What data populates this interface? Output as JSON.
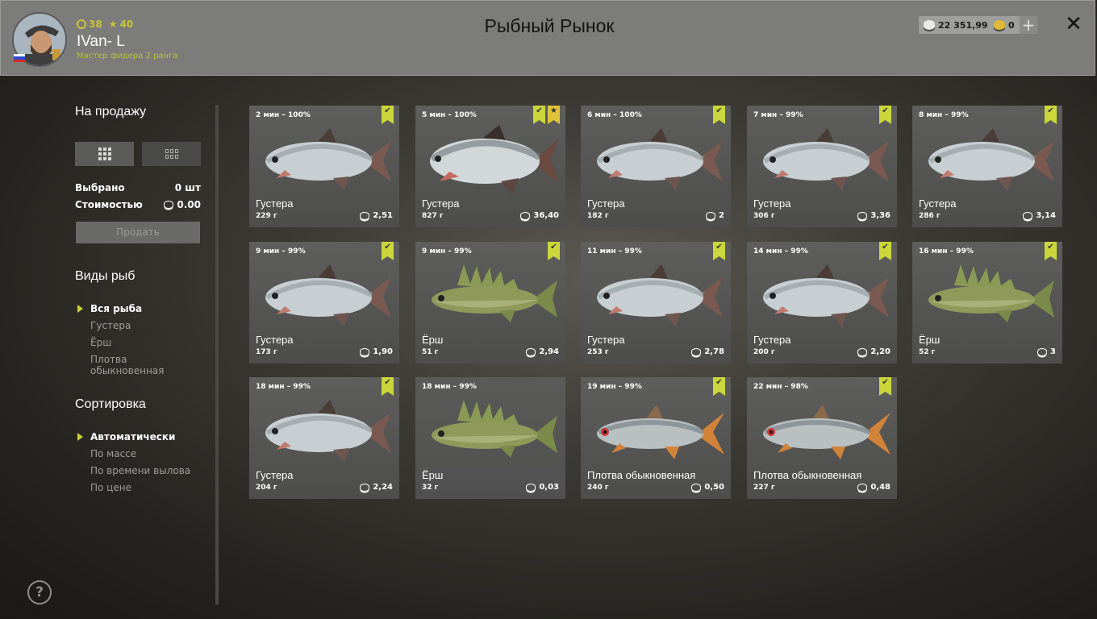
{
  "header": {
    "title": "Рыбный Рынок",
    "player": {
      "name": "IVan- L",
      "rank": "Мастер фидера 2 ранга",
      "level": "38",
      "stars": "40"
    },
    "currency": {
      "silver": "22 351,99",
      "gold": "0"
    },
    "plus_label": "+",
    "close_label": "✕"
  },
  "sale": {
    "title": "На продажу",
    "selected_label": "Выбрано",
    "selected_value": "0 шт",
    "cost_label": "Стоимостью",
    "cost_value": "0.00",
    "sell_label": "Продать"
  },
  "species": {
    "title": "Виды рыб",
    "items": [
      "Вся рыба",
      "Густера",
      "Ёрш",
      "Плотва обыкновенная"
    ]
  },
  "sorting": {
    "title": "Сортировка",
    "items": [
      "Автоматически",
      "По массе",
      "По времени вылова",
      "По цене"
    ]
  },
  "help_label": "?",
  "fish": [
    {
      "time": "2 мин – 100%",
      "name": "Густера",
      "weight": "229 г",
      "price": "2,51",
      "species": "bream",
      "check": true,
      "star": false
    },
    {
      "time": "5 мин – 100%",
      "name": "Густера",
      "weight": "827 г",
      "price": "36,40",
      "species": "bream-big",
      "check": true,
      "star": true
    },
    {
      "time": "6 мин – 100%",
      "name": "Густера",
      "weight": "182 г",
      "price": "2",
      "species": "bream",
      "check": true,
      "star": false
    },
    {
      "time": "7 мин – 99%",
      "name": "Густера",
      "weight": "306 г",
      "price": "3,36",
      "species": "bream",
      "check": true,
      "star": false
    },
    {
      "time": "8 мин – 99%",
      "name": "Густера",
      "weight": "286 г",
      "price": "3,14",
      "species": "bream",
      "check": true,
      "star": false
    },
    {
      "time": "9 мин – 99%",
      "name": "Густера",
      "weight": "173 г",
      "price": "1,90",
      "species": "bream",
      "check": true,
      "star": false
    },
    {
      "time": "9 мин – 99%",
      "name": "Ёрш",
      "weight": "51 г",
      "price": "2,94",
      "species": "ruffe",
      "check": true,
      "star": false
    },
    {
      "time": "11 мин – 99%",
      "name": "Густера",
      "weight": "253 г",
      "price": "2,78",
      "species": "bream",
      "check": true,
      "star": false
    },
    {
      "time": "14 мин – 99%",
      "name": "Густера",
      "weight": "200 г",
      "price": "2,20",
      "species": "bream",
      "check": true,
      "star": false
    },
    {
      "time": "16 мин – 99%",
      "name": "Ёрш",
      "weight": "52 г",
      "price": "3",
      "species": "ruffe",
      "check": true,
      "star": false
    },
    {
      "time": "18 мин – 99%",
      "name": "Густера",
      "weight": "204 г",
      "price": "2,24",
      "species": "bream",
      "check": true,
      "star": false
    },
    {
      "time": "18 мин – 99%",
      "name": "Ёрш",
      "weight": "32 г",
      "price": "0,03",
      "species": "ruffe",
      "check": false,
      "star": false
    },
    {
      "time": "19 мин – 99%",
      "name": "Плотва обыкновенная",
      "weight": "240 г",
      "price": "0,50",
      "species": "roach",
      "check": true,
      "star": false
    },
    {
      "time": "22 мин – 98%",
      "name": "Плотва обыкновенная",
      "weight": "227 г",
      "price": "0,48",
      "species": "roach",
      "check": true,
      "star": false
    }
  ]
}
